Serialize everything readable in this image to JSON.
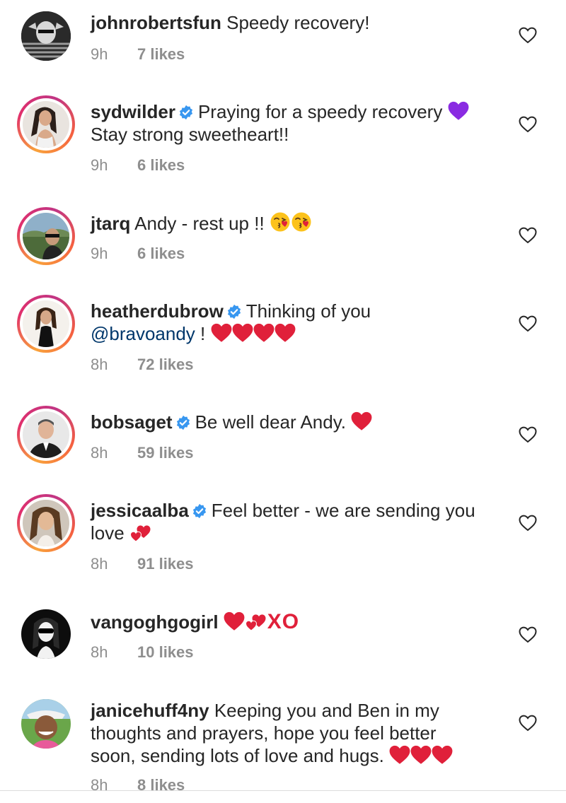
{
  "colors": {
    "username": "#262626",
    "meta": "#8e8e8e",
    "verified": "#3897f0",
    "mention": "#00376b",
    "heart_emoji": "#e0203a",
    "purple_heart": "#8a2be2"
  },
  "comments": [
    {
      "username": "johnrobertsfun",
      "verified": false,
      "text": "Speedy recovery!",
      "time": "9h",
      "likes": "7 likes"
    },
    {
      "username": "sydwilder",
      "verified": true,
      "text": "Praying for a speedy recovery",
      "text2": "Stay strong sweetheart!!",
      "emoji": "purple-heart",
      "time": "9h",
      "likes": "6 likes"
    },
    {
      "username": "jtarq",
      "verified": false,
      "text": "Andy - rest up !!",
      "emoji": "kissing-face x2",
      "time": "9h",
      "likes": "6 likes"
    },
    {
      "username": "heatherdubrow",
      "verified": true,
      "text": "Thinking of you",
      "mention": "@bravoandy",
      "text_after": " !",
      "emoji": "red-heart x4",
      "time": "8h",
      "likes": "72 likes"
    },
    {
      "username": "bobsaget",
      "verified": true,
      "text": "Be well dear Andy.",
      "emoji": "red-heart",
      "time": "8h",
      "likes": "59 likes"
    },
    {
      "username": "jessicaalba",
      "verified": true,
      "text": "Feel better - we are sending you",
      "text2": "love",
      "emoji": "two-hearts",
      "time": "8h",
      "likes": "91 likes"
    },
    {
      "username": "vangoghgogirl",
      "verified": false,
      "text": "",
      "emoji": "red-heart two-hearts",
      "xo": "XO",
      "time": "8h",
      "likes": "10 likes"
    },
    {
      "username": "janicehuff4ny",
      "verified": false,
      "text": "Keeping you and Ben in my",
      "text2": "thoughts and prayers, hope you feel better",
      "text3": "soon, sending lots of love and hugs.",
      "emoji": "red-heart x3",
      "time": "8h",
      "likes": "8 likes"
    }
  ]
}
